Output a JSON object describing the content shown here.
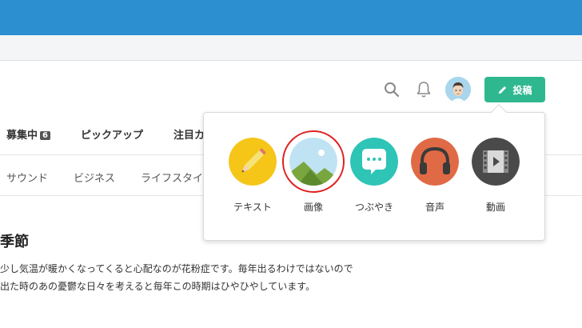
{
  "header": {
    "post_button_label": "投稿"
  },
  "tabs": [
    {
      "label": "募集中",
      "badge": "6"
    },
    {
      "label": "ピックアップ"
    },
    {
      "label": "注目カ"
    }
  ],
  "subtabs": [
    "サウンド",
    "ビジネス",
    "ライフスタイ"
  ],
  "article": {
    "title": "季節",
    "line1": "少し気温が暖かくなってくると心配なのが花粉症です。毎年出るわけではないので",
    "line2": "出た時のあの憂鬱な日々を考えると毎年この時期はひやひやしています。"
  },
  "post_types": [
    {
      "label": "テキスト",
      "icon": "pencil-icon",
      "color": "#f5c518"
    },
    {
      "label": "画像",
      "icon": "image-icon",
      "color": "#bfe3f2"
    },
    {
      "label": "つぶやき",
      "icon": "speech-bubble-icon",
      "color": "#2ec4b6"
    },
    {
      "label": "音声",
      "icon": "headphones-icon",
      "color": "#e06a45"
    },
    {
      "label": "動画",
      "icon": "film-icon",
      "color": "#4a4a4a"
    }
  ],
  "colors": {
    "brand_blue": "#2b8fd0",
    "accent_green": "#2fb88f",
    "highlight_red": "#e02020"
  }
}
